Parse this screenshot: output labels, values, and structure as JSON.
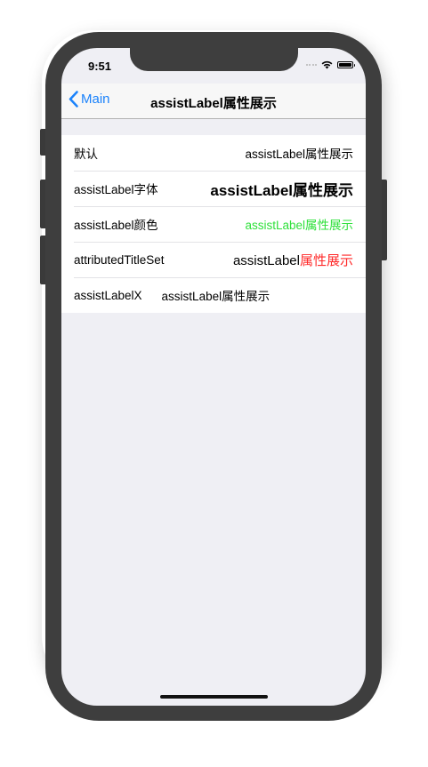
{
  "status_bar": {
    "time": "9:51",
    "icons": [
      "signal-dots-icon",
      "wifi-icon",
      "battery-icon"
    ]
  },
  "nav": {
    "back_label": "Main",
    "title": "assistLabel属性展示",
    "accent_color": "#1a82fb"
  },
  "rows": [
    {
      "label": "默认",
      "value": "assistLabel属性展示"
    },
    {
      "label": "assistLabel字体",
      "value": "assistLabel属性展示"
    },
    {
      "label": "assistLabel颜色",
      "value": "assistLabel属性展示",
      "value_color": "#2ee03a"
    },
    {
      "label": "attributedTitleSet",
      "value_part1": "assistLabel",
      "value_part2": "属性展示",
      "value_part2_color": "#ff2a2a"
    },
    {
      "label": "assistLabelX",
      "value": "assistLabel属性展示"
    }
  ]
}
